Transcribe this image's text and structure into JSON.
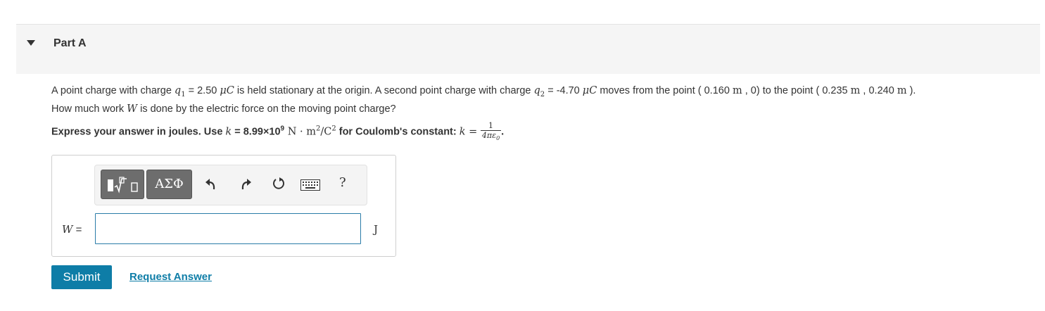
{
  "part": {
    "title": "Part A"
  },
  "question": {
    "t1": "A point charge with charge ",
    "q1_sym": "q",
    "q1_sub": "1",
    "t2": " = 2.50 ",
    "unit_uC": "μC",
    "t3": " is held stationary at the origin. A second point charge with charge ",
    "q2_sym": "q",
    "q2_sub": "2",
    "t4": " = -4.70 ",
    "t5": " moves from the point ( 0.160 ",
    "unit_m": "m",
    "t6": " , 0) to the point ( 0.235 ",
    "t7": " , 0.240 ",
    "t8": " ).",
    "t9": "How much work ",
    "w_sym": "W",
    "t10": " is done by the electric force on the moving point charge?"
  },
  "instruction": {
    "t1": "Express your answer in joules. Use ",
    "k_sym": "k",
    "t2": " = 8.99×10",
    "exp": "9",
    "unit_N": " N · m",
    "sq": "2",
    "unit_C": "/C",
    "sq2": "2",
    "t3": " for Coulomb's constant: ",
    "k_sym2": "k",
    "eq": " = ",
    "frac_num": "1",
    "frac_den": "4πε",
    "frac_den_sub": "0",
    "end": "."
  },
  "toolbar": {
    "greek_label": "ΑΣΦ",
    "help_label": "?",
    "icons": [
      "templates-icon",
      "greek-symbols-icon",
      "undo-icon",
      "redo-icon",
      "reset-icon",
      "keyboard-icon",
      "help-icon"
    ]
  },
  "answer": {
    "var_label": "W",
    "equals": " =",
    "value": "",
    "unit": "J"
  },
  "buttons": {
    "submit_label": "Submit",
    "request_label": "Request Answer"
  },
  "colors": {
    "accent": "#0e7da7",
    "header_bg": "#f5f5f5",
    "toolbar_button": "#6d6d6d"
  }
}
